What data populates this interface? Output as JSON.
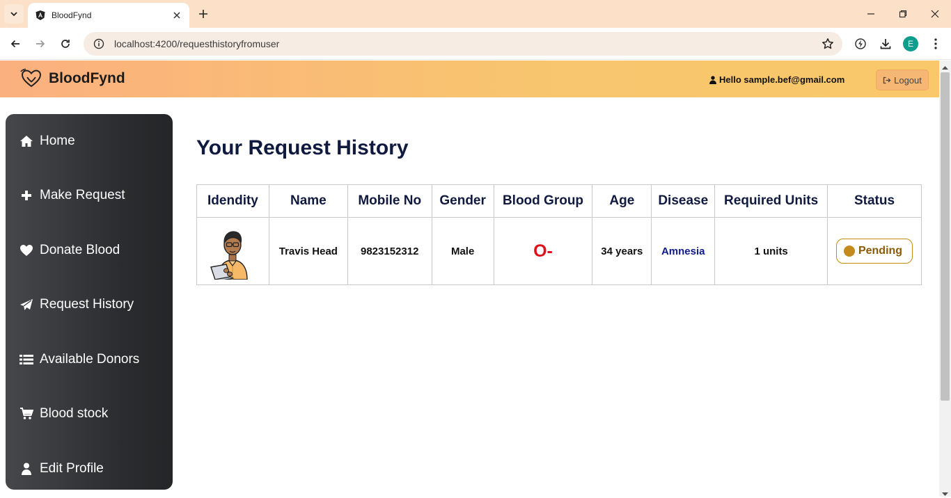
{
  "browser": {
    "tab_title": "BloodFynd",
    "url": "localhost:4200/requesthistoryfromuser",
    "avatar_letter": "E"
  },
  "header": {
    "brand": "BloodFynd",
    "greeting": "Hello sample.bef@gmail.com",
    "logout_label": "Logout"
  },
  "sidebar": {
    "items": [
      {
        "label": "Home",
        "icon": "home-icon"
      },
      {
        "label": "Make Request",
        "icon": "plus-icon"
      },
      {
        "label": "Donate Blood",
        "icon": "heart-icon"
      },
      {
        "label": "Request History",
        "icon": "paper-plane-icon"
      },
      {
        "label": "Available Donors",
        "icon": "list-icon"
      },
      {
        "label": "Blood stock",
        "icon": "cart-icon"
      },
      {
        "label": "Edit Profile",
        "icon": "user-icon"
      }
    ]
  },
  "main": {
    "title": "Your Request History",
    "columns": [
      "Idendity",
      "Name",
      "Mobile No",
      "Gender",
      "Blood Group",
      "Age",
      "Disease",
      "Required Units",
      "Status"
    ],
    "rows": [
      {
        "name": "Travis Head",
        "mobile": "9823152312",
        "gender": "Male",
        "blood_group": "O-",
        "age": "34 years",
        "disease": "Amnesia",
        "units": "1 units",
        "status": "Pending"
      }
    ]
  },
  "colors": {
    "header_start": "#fbb07f",
    "header_end": "#f8c86a",
    "sidebar": "#2b2c2f",
    "title": "#101a3f",
    "blood_group": "#e0101a",
    "status": "#c48a1e"
  }
}
